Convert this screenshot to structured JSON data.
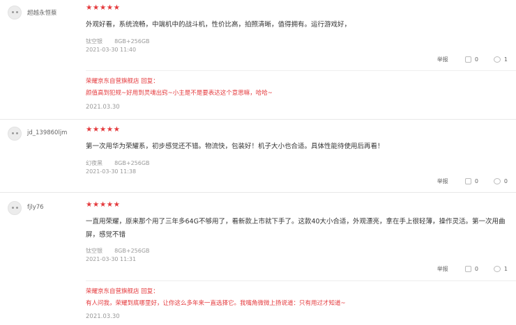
{
  "reviews": [
    {
      "user": "超越永恒蔡",
      "stars": "★★★★★",
      "content": "外观好看，系统流畅，中端机中的战斗机，性价比高，拍照清晰，值得拥有。运行游戏好，",
      "color": "钛空银",
      "spec": "8GB+256GB",
      "date": "2021-03-30 11:40",
      "report": "举报",
      "likes": "0",
      "comments": "1",
      "reply": {
        "head": "荣耀京东自营旗舰店 回复：",
        "text": "颜值高到犯规~好用到灵魂出窍~小主是不是要表达这个意思嘛，哈哈~",
        "date": "2021.03.30"
      }
    },
    {
      "user": "jd_139860ljm",
      "stars": "★★★★★",
      "content": "第一次用华为荣耀系，初步感觉还不错。物流快，包装好！机子大小也合适。具体性能待使用后再看！",
      "color": "幻夜黑",
      "spec": "8GB+256GB",
      "date": "2021-03-30 11:38",
      "report": "举报",
      "likes": "0",
      "comments": "0"
    },
    {
      "user": "fjly76",
      "stars": "★★★★★",
      "content": "一直用荣耀，原来那个用了三年多64G不够用了，看新款上市就下手了。这款40大小合适，外观漂亮，拿在手上很轻薄，操作灵活。第一次用曲屏，感觉不错",
      "color": "钛空银",
      "spec": "8GB+256GB",
      "date": "2021-03-30 11:31",
      "report": "举报",
      "likes": "0",
      "comments": "1",
      "reply": {
        "head": "荣耀京东自营旗舰店 回复：",
        "text": "有人问我，荣耀到底哪里好，让你这么多年来一直选择它。我嘴角微微上扬说道：只有用过才知道~",
        "date": "2021.03.30"
      }
    }
  ]
}
